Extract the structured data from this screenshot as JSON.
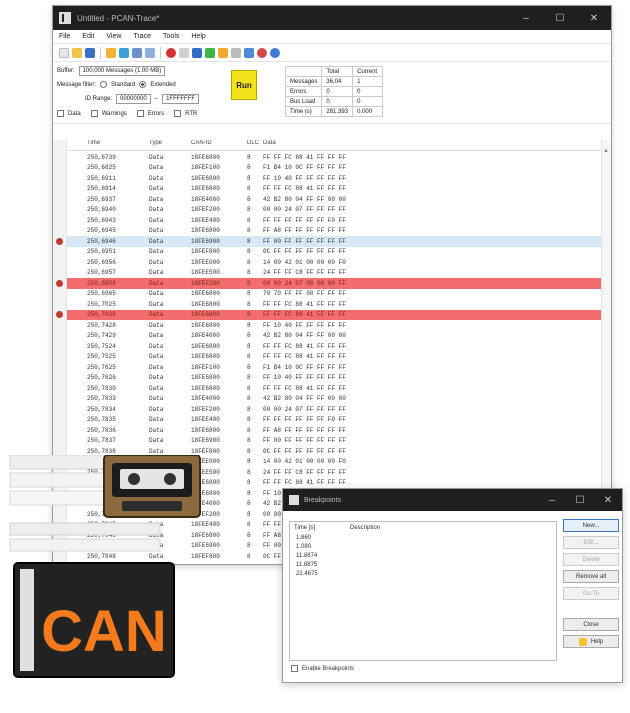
{
  "main": {
    "title": "Untitled - PCAN-Trace*",
    "menu": [
      "File",
      "Edit",
      "View",
      "Trace",
      "Tools",
      "Help"
    ],
    "filter": {
      "buffer_label": "Buffer:",
      "buffer_value": "100,000 Messages (1.00 MB)",
      "message_filter_label": "Message filter:",
      "standard_label": "Standard",
      "extended_label": "Extended",
      "id_range_label": "ID Range:",
      "id_from": "00000000",
      "id_to": "1FFFFFFF",
      "checkbox_data": "Data",
      "checkbox_warnings": "Warnings",
      "checkbox_errors": "Errors",
      "checkbox_rtr": "RTR"
    },
    "run_label": "Run",
    "stats": {
      "col_total": "Total",
      "col_current": "Current",
      "rows": [
        {
          "label": "Messages",
          "total": "36,04",
          "current": "1"
        },
        {
          "label": "Errors",
          "total": "0",
          "current": "0"
        },
        {
          "label": "Bus Load",
          "total": "0",
          "current": "0"
        },
        {
          "label": "Time (s)",
          "total": "281.393",
          "current": "0.000"
        }
      ]
    },
    "columns": [
      "Time",
      "Type",
      "CAN-ID",
      "DLC",
      "Data"
    ],
    "rows": [
      {
        "time": "250,6739",
        "type": "Data",
        "id": "18FE6800",
        "dlc": "8",
        "data": "FF FF FC 88 41 FF FF FF",
        "hl": ""
      },
      {
        "time": "250,6825",
        "type": "Data",
        "id": "18FEF100",
        "dlc": "8",
        "data": "F1 B4 10 0C FF FF FF FF",
        "hl": ""
      },
      {
        "time": "250,6911",
        "type": "Data",
        "id": "18FE6800",
        "dlc": "8",
        "data": "FF 10 40 FF FF FF FF FF",
        "hl": ""
      },
      {
        "time": "250,6914",
        "type": "Data",
        "id": "18FE6800",
        "dlc": "8",
        "data": "FF FF FC 88 41 FF FF FF",
        "hl": ""
      },
      {
        "time": "250,6937",
        "type": "Data",
        "id": "18FE4000",
        "dlc": "8",
        "data": "42 B2 80 04 FF FF 00 00",
        "hl": ""
      },
      {
        "time": "250,6940",
        "type": "Data",
        "id": "18FEF200",
        "dlc": "8",
        "data": "00 00 24 07 FF FF FF FF",
        "hl": ""
      },
      {
        "time": "250,6943",
        "type": "Data",
        "id": "18FEE400",
        "dlc": "8",
        "data": "FF FF FF FF FF FF F0 FF",
        "hl": ""
      },
      {
        "time": "250,6945",
        "type": "Data",
        "id": "18FE6800",
        "dlc": "8",
        "data": "FF A8 FF FF FF FF FF FF",
        "hl": ""
      },
      {
        "time": "250,6946",
        "type": "Data",
        "id": "18FE6900",
        "dlc": "8",
        "data": "FF 00 FF FF FF FF FF FF",
        "hl": "blue"
      },
      {
        "time": "250,6951",
        "type": "Data",
        "id": "18FEF800",
        "dlc": "8",
        "data": "0C FF FF FF FF FF FF FF",
        "hl": ""
      },
      {
        "time": "250,6956",
        "type": "Data",
        "id": "18FEE000",
        "dlc": "8",
        "data": "14 00 42 01 00 00 00 F0",
        "hl": ""
      },
      {
        "time": "250,6957",
        "type": "Data",
        "id": "18FEE500",
        "dlc": "8",
        "data": "24 FF FF C8 FF FF FF FF",
        "hl": ""
      },
      {
        "time": "250,6958",
        "type": "Data",
        "id": "18FEF200",
        "dlc": "8",
        "data": "00 00 24 07 00 00 00 FF",
        "hl": "red"
      },
      {
        "time": "250,6965",
        "type": "Data",
        "id": "18FE6800",
        "dlc": "8",
        "data": "70 70 FF FF 00 FF FF FF",
        "hl": ""
      },
      {
        "time": "250,7025",
        "type": "Data",
        "id": "18FE6800",
        "dlc": "8",
        "data": "FF FF FC 88 41 FF FF FF",
        "hl": ""
      },
      {
        "time": "250,7026",
        "type": "Data",
        "id": "18FE6800",
        "dlc": "8",
        "data": "FF FF FC 88 41 FF FF FF",
        "hl": "red"
      },
      {
        "time": "250,7428",
        "type": "Data",
        "id": "18FE6800",
        "dlc": "8",
        "data": "FF 10 40 FF FF FF FF FF",
        "hl": ""
      },
      {
        "time": "250,7429",
        "type": "Data",
        "id": "18FE4000",
        "dlc": "8",
        "data": "42 B2 80 04 FF FF 00 00",
        "hl": ""
      },
      {
        "time": "250,7524",
        "type": "Data",
        "id": "18FE6800",
        "dlc": "8",
        "data": "FF FF FC 88 41 FF FF FF",
        "hl": ""
      },
      {
        "time": "250,7525",
        "type": "Data",
        "id": "18FE6800",
        "dlc": "8",
        "data": "FF FF FC 88 41 FF FF FF",
        "hl": ""
      },
      {
        "time": "250,7625",
        "type": "Data",
        "id": "18FEF100",
        "dlc": "8",
        "data": "F1 B4 10 0C FF FF FF FF",
        "hl": ""
      },
      {
        "time": "250,7626",
        "type": "Data",
        "id": "18FE6800",
        "dlc": "8",
        "data": "FF 10 40 FF FF FF FF FF",
        "hl": ""
      },
      {
        "time": "250,7830",
        "type": "Data",
        "id": "18FE6800",
        "dlc": "8",
        "data": "FF FF FC 88 41 FF FF FF",
        "hl": ""
      },
      {
        "time": "250,7833",
        "type": "Data",
        "id": "18FE4000",
        "dlc": "8",
        "data": "42 B2 80 04 FF FF 00 00",
        "hl": ""
      },
      {
        "time": "250,7834",
        "type": "Data",
        "id": "18FEF200",
        "dlc": "8",
        "data": "00 00 24 07 FF FF FF FF",
        "hl": ""
      },
      {
        "time": "250,7835",
        "type": "Data",
        "id": "18FEE400",
        "dlc": "8",
        "data": "FF FF FF FF FF FF F0 FF",
        "hl": ""
      },
      {
        "time": "250,7836",
        "type": "Data",
        "id": "18FE6800",
        "dlc": "8",
        "data": "FF A8 FF FF FF FF FF FF",
        "hl": ""
      },
      {
        "time": "250,7837",
        "type": "Data",
        "id": "18FE6900",
        "dlc": "8",
        "data": "FF 00 FF FF FF FF FF FF",
        "hl": ""
      },
      {
        "time": "250,7838",
        "type": "Data",
        "id": "18FEF800",
        "dlc": "8",
        "data": "0C FF FF FF FF FF FF FF",
        "hl": ""
      },
      {
        "time": "250,7839",
        "type": "Data",
        "id": "18FEE000",
        "dlc": "8",
        "data": "14 00 42 01 00 00 00 F0",
        "hl": ""
      },
      {
        "time": "250,7840",
        "type": "Data",
        "id": "18FEE500",
        "dlc": "8",
        "data": "24 FF FF C8 FF FF FF FF",
        "hl": ""
      },
      {
        "time": "250,7841",
        "type": "Data",
        "id": "18FE6800",
        "dlc": "8",
        "data": "FF FF FC 88 41 FF FF FF",
        "hl": ""
      },
      {
        "time": "250,7842",
        "type": "Data",
        "id": "18FE6800",
        "dlc": "8",
        "data": "FF 10 40 FF FF FF FF FF",
        "hl": ""
      },
      {
        "time": "250,7843",
        "type": "Data",
        "id": "18FE4000",
        "dlc": "8",
        "data": "42 B2 80 04 FF FF 00 00",
        "hl": ""
      },
      {
        "time": "250,7844",
        "type": "Data",
        "id": "18FEF200",
        "dlc": "8",
        "data": "00 00 24 07 FF FF FF FF",
        "hl": ""
      },
      {
        "time": "250,7845",
        "type": "Data",
        "id": "18FEE400",
        "dlc": "8",
        "data": "FF FF FF FF FF FF F0 FF",
        "hl": ""
      },
      {
        "time": "250,7846",
        "type": "Data",
        "id": "18FE6800",
        "dlc": "8",
        "data": "FF A8 FF FF FF FF FF FF",
        "hl": ""
      },
      {
        "time": "250,7847",
        "type": "Data",
        "id": "18FE6900",
        "dlc": "8",
        "data": "FF 00 FF FF FF FF FF FF",
        "hl": ""
      },
      {
        "time": "250,7848",
        "type": "Data",
        "id": "18FEF800",
        "dlc": "8",
        "data": "0C FF FF FF FF FF FF FF",
        "hl": ""
      }
    ],
    "breakpoint_rows": [
      8,
      12,
      15
    ]
  },
  "breakpoints": {
    "title": "Breakpoints",
    "col_time": "Time [s]",
    "col_description": "Description",
    "items": [
      "1.860",
      "1.080",
      "11.8874",
      "11.8875",
      "22.4675"
    ],
    "buttons": {
      "new": "New...",
      "edit": "Edit...",
      "delete": "Delete",
      "remove_all": "Remove all",
      "goto": "Go To",
      "close": "Close",
      "help": "Help"
    },
    "enable_label": "Enable Breakpoints"
  },
  "logo": {
    "text": "CAN"
  },
  "colors": {
    "highlight_blue": "#d7e9f7",
    "highlight_red": "#f36d6d",
    "run_yellow": "#f4e21c",
    "titlebar": "#1f1f1f",
    "logo_orange": "#f47a1c"
  }
}
